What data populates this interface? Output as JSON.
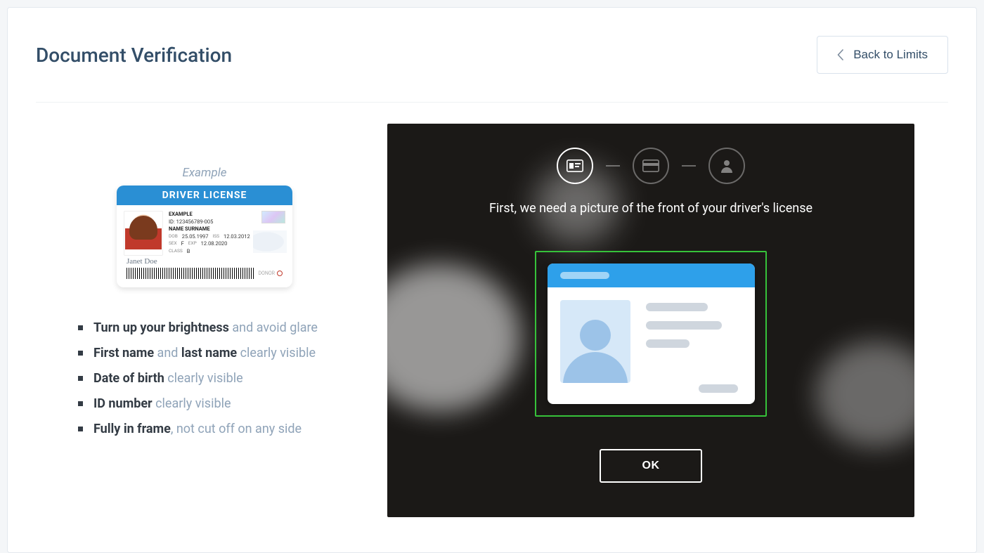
{
  "header": {
    "title": "Document Verification",
    "back_label": "Back to Limits"
  },
  "example": {
    "label": "Example",
    "card": {
      "title": "DRIVER LICENSE",
      "example_label": "EXAMPLE",
      "id_line": "ID: 123456789-005",
      "name_line": "NAME SURNAME",
      "dob_label": "DOB",
      "dob_value": "25.05.1997",
      "iss_label": "ISS",
      "iss_value": "12.03.2012",
      "sex_label": "SEX",
      "sex_value": "F",
      "exp_label": "EXP",
      "exp_value": "12.08.2020",
      "class_label": "CLASS",
      "class_value": "B",
      "donor_label": "DONOR",
      "signature": "Janet Doe"
    }
  },
  "tips": [
    {
      "bold1": "Turn up your brightness",
      "rest1": " and avoid glare"
    },
    {
      "bold1": "First name",
      "rest1": " and ",
      "bold2": "last name",
      "rest2": " clearly visible"
    },
    {
      "bold1": "Date of birth",
      "rest1": " clearly visible"
    },
    {
      "bold1": "ID number",
      "rest1": " clearly visible"
    },
    {
      "bold1": "Fully in frame",
      "rest1": ", not cut off on any side"
    }
  ],
  "camera": {
    "instruction": "First, we need a picture of the front of your driver's license",
    "ok_label": "OK"
  }
}
